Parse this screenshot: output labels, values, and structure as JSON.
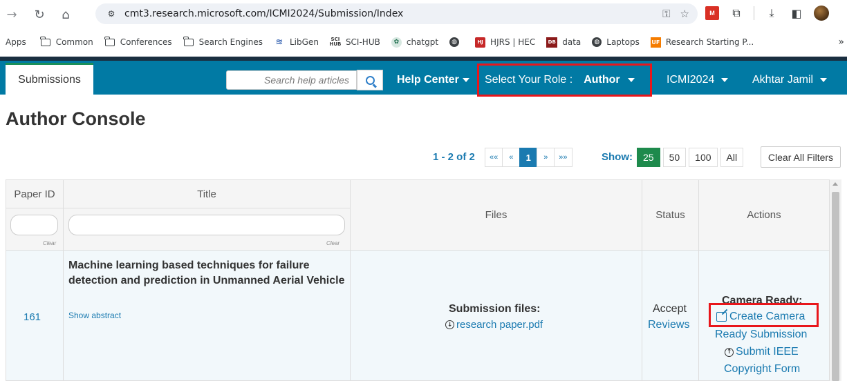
{
  "browser": {
    "url": "cmt3.research.microsoft.com/ICMI2024/Submission/Index",
    "bookmarks": [
      {
        "label": "Apps",
        "icon": "none"
      },
      {
        "label": "Common",
        "icon": "folder-icon"
      },
      {
        "label": "Conferences",
        "icon": "folder-icon"
      },
      {
        "label": "Search Engines",
        "icon": "folder-icon"
      },
      {
        "label": "LibGen",
        "icon": "libgen-icon"
      },
      {
        "label": "SCI-HUB",
        "icon": "scihub-icon"
      },
      {
        "label": "chatgpt",
        "icon": "chatgpt-icon"
      },
      {
        "label": "",
        "icon": "globe-icon"
      },
      {
        "label": "HJRS | HEC",
        "icon": "hjrs-icon"
      },
      {
        "label": "data",
        "icon": "data-icon"
      },
      {
        "label": "Laptops",
        "icon": "globe-icon"
      },
      {
        "label": "Research Starting P...",
        "icon": "uf-icon"
      }
    ],
    "bookmark_more": "»"
  },
  "navbar": {
    "submissions_tab": "Submissions",
    "search_placeholder": "Search help articles",
    "help_center": "Help Center",
    "role_label": "Select Your Role :",
    "role_value": "Author",
    "conference": "ICMI2024",
    "user": "Akhtar Jamil"
  },
  "page": {
    "title": "Author Console"
  },
  "pagination": {
    "count": "1 - 2 of 2",
    "first": "««",
    "prev": "«",
    "current": "1",
    "next": "»",
    "last": "»»",
    "show_label": "Show:",
    "sizes": [
      "25",
      "50",
      "100",
      "All"
    ],
    "active_size": "25",
    "clear_filters": "Clear All Filters"
  },
  "table": {
    "headers": {
      "paper_id": "Paper ID",
      "title": "Title",
      "files": "Files",
      "status": "Status",
      "actions": "Actions"
    },
    "clear_label": "Clear",
    "rows": [
      {
        "paper_id": "161",
        "title": "Machine learning based techniques for failure detection and prediction in Unmanned Aerial Vehicle",
        "show_abstract": "Show abstract",
        "files_label": "Submission files:",
        "file_name": "research paper.pdf",
        "status": "Accept",
        "reviews": "Reviews",
        "camera_label": "Camera Ready:",
        "create_camera": "Create Camera",
        "ready_submission": "Ready Submission",
        "submit_ieee": "Submit IEEE",
        "copyright_form": "Copyright Form"
      }
    ]
  },
  "colors": {
    "navbar": "#017aa4",
    "highlight": "#e8161b",
    "link": "#1a7ab0",
    "active_size": "#1e8a4c"
  }
}
